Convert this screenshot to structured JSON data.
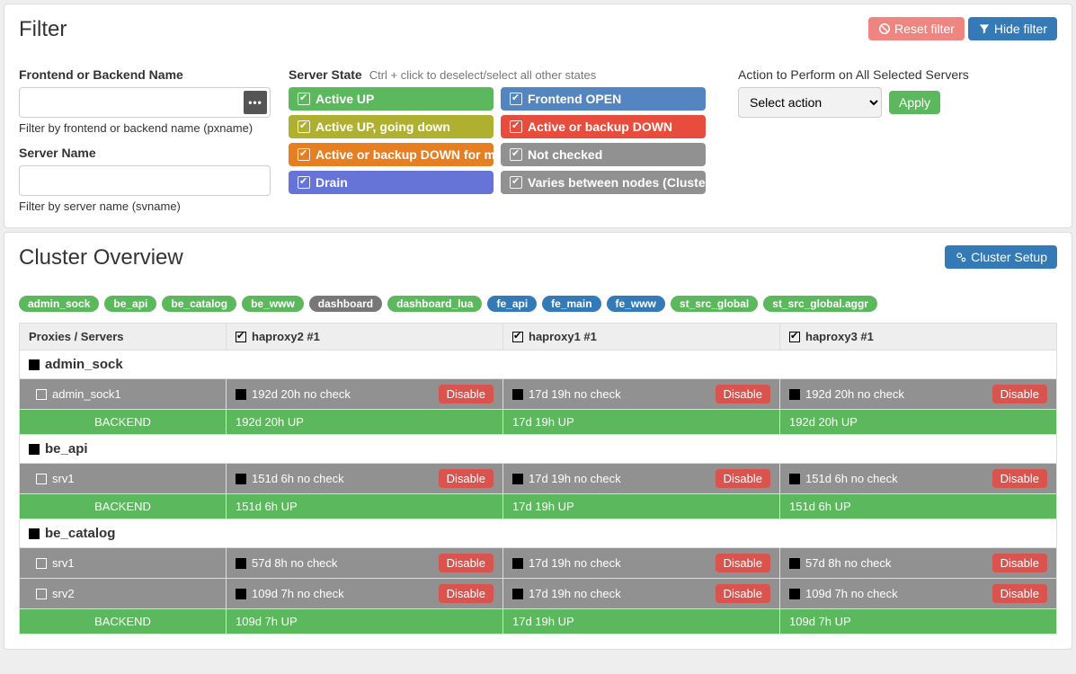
{
  "filter": {
    "title": "Filter",
    "reset": "Reset filter",
    "hide": "Hide filter",
    "name_label": "Frontend or Backend Name",
    "name_hint": "Filter by frontend or backend name (pxname)",
    "server_label": "Server Name",
    "server_hint": "Filter by server name (svname)",
    "state_label": "Server State",
    "state_help": "Ctrl + click to deselect/select all other states",
    "states": [
      {
        "label": "Active UP",
        "bg": "#5cb85c"
      },
      {
        "label": "Frontend OPEN",
        "bg": "#5385c1"
      },
      {
        "label": "Active UP, going down",
        "bg": "#b0b030"
      },
      {
        "label": "Active or backup DOWN",
        "bg": "#e74c3c"
      },
      {
        "label": "Active or backup DOWN for maintenance",
        "bg": "#e67e22"
      },
      {
        "label": "Not checked",
        "bg": "#919191"
      },
      {
        "label": "Drain",
        "bg": "#6673d7"
      },
      {
        "label": "Varies between nodes (Cluster)",
        "bg": "#919191"
      }
    ],
    "action_label": "Action to Perform on All Selected Servers",
    "select_placeholder": "Select action",
    "apply": "Apply"
  },
  "overview": {
    "title": "Cluster Overview",
    "setup": "Cluster Setup",
    "tags": [
      {
        "t": "admin_sock",
        "c": "g"
      },
      {
        "t": "be_api",
        "c": "g"
      },
      {
        "t": "be_catalog",
        "c": "g"
      },
      {
        "t": "be_www",
        "c": "g"
      },
      {
        "t": "dashboard",
        "c": "x"
      },
      {
        "t": "dashboard_lua",
        "c": "g"
      },
      {
        "t": "fe_api",
        "c": "b"
      },
      {
        "t": "fe_main",
        "c": "b"
      },
      {
        "t": "fe_www",
        "c": "b"
      },
      {
        "t": "st_src_global",
        "c": "g"
      },
      {
        "t": "st_src_global.aggr",
        "c": "g"
      }
    ],
    "col0": "Proxies / Servers",
    "nodes": [
      "haproxy2 #1",
      "haproxy1 #1",
      "haproxy3 #1"
    ],
    "disable": "Disable",
    "groups": [
      {
        "name": "admin_sock",
        "rows": [
          {
            "srv": "admin_sock1",
            "cells": [
              "192d 20h no check",
              "17d 19h no check",
              "192d 20h no check"
            ]
          }
        ],
        "backend": [
          "192d 20h UP",
          "17d 19h UP",
          "192d 20h UP"
        ]
      },
      {
        "name": "be_api",
        "rows": [
          {
            "srv": "srv1",
            "cells": [
              "151d 6h no check",
              "17d 19h no check",
              "151d 6h no check"
            ]
          }
        ],
        "backend": [
          "151d 6h UP",
          "17d 19h UP",
          "151d 6h UP"
        ]
      },
      {
        "name": "be_catalog",
        "rows": [
          {
            "srv": "srv1",
            "cells": [
              "57d 8h no check",
              "17d 19h no check",
              "57d 8h no check"
            ]
          },
          {
            "srv": "srv2",
            "cells": [
              "109d 7h no check",
              "17d 19h no check",
              "109d 7h no check"
            ]
          }
        ],
        "backend": [
          "109d 7h UP",
          "17d 19h UP",
          "109d 7h UP"
        ]
      }
    ],
    "backend_label": "BACKEND"
  }
}
